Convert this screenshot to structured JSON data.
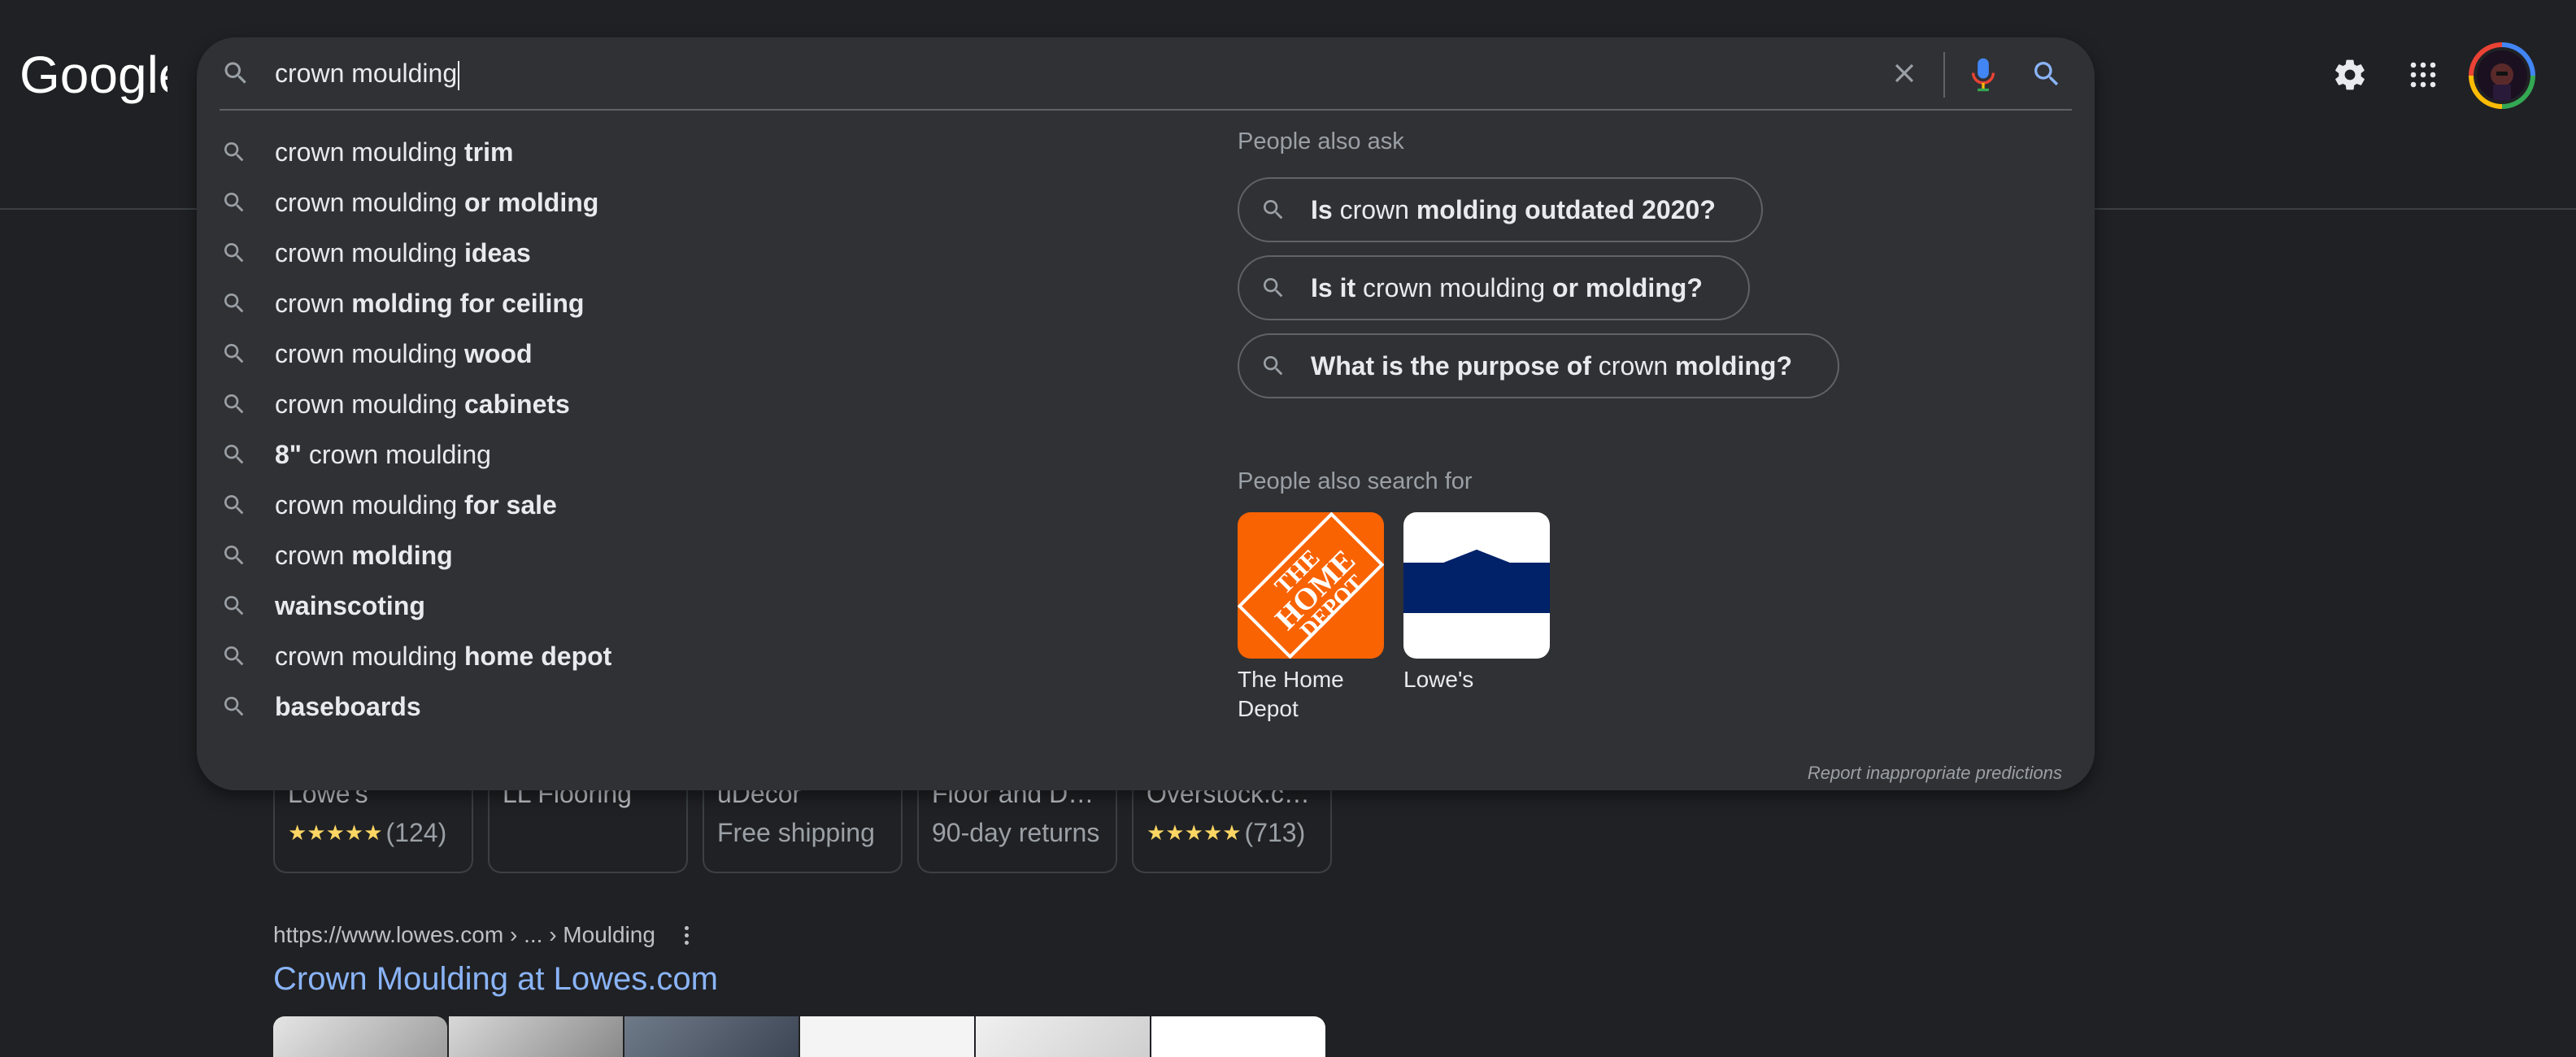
{
  "brand": {
    "logo_text": "Google"
  },
  "search": {
    "query": "crown moulding",
    "clear_icon": "close-icon",
    "voice_icon": "mic-icon",
    "submit_icon": "search-icon"
  },
  "header": {
    "settings_icon": "gear-icon",
    "apps_icon": "apps-grid-icon",
    "avatar_icon": "account-avatar"
  },
  "suggestions": [
    {
      "plain": "crown moulding ",
      "bold": "trim"
    },
    {
      "plain": "crown moulding ",
      "bold": "or molding"
    },
    {
      "plain": "crown moulding ",
      "bold": "ideas"
    },
    {
      "plain": "crown ",
      "bold": "molding for ceiling"
    },
    {
      "plain": "crown moulding ",
      "bold": "wood"
    },
    {
      "plain": "crown moulding ",
      "bold": "cabinets"
    },
    {
      "bold_first": "8\"",
      "plain": " crown moulding"
    },
    {
      "plain": "crown moulding ",
      "bold": "for sale"
    },
    {
      "plain": "crown ",
      "bold": "molding"
    },
    {
      "bold": "wainscoting"
    },
    {
      "plain": "crown moulding ",
      "bold": "home depot"
    },
    {
      "bold": "baseboards"
    }
  ],
  "people_also_ask": {
    "label": "People also ask",
    "questions": [
      {
        "p1_bold": "Is",
        "p2": " crown ",
        "p3_bold": "molding outdated 2020?"
      },
      {
        "p1_bold": "Is it",
        "p2": " crown moulding ",
        "p3_bold": "or molding?"
      },
      {
        "p1_bold": "What is the purpose of",
        "p2": " crown ",
        "p3_bold": "molding?"
      }
    ]
  },
  "people_also_search": {
    "label": "People also search for",
    "items": [
      {
        "name": "The Home Depot",
        "logo_text": "THE HOME DEPOT",
        "color": "#f96302"
      },
      {
        "name": "Lowe's",
        "color": "#012169"
      }
    ]
  },
  "report_link": "Report inappropriate predictions",
  "background": {
    "stores": [
      {
        "name": "Lowe's",
        "rating_stars": "★★★★★",
        "rating_count": "(124)"
      },
      {
        "name": "LL Flooring",
        "sub": ""
      },
      {
        "name": "uDecor",
        "sub": "Free shipping"
      },
      {
        "name": "Floor and De…",
        "sub": "90-day returns"
      },
      {
        "name": "Overstock.co…",
        "rating_stars": "★★★★★",
        "rating_count": "(713)"
      }
    ],
    "result": {
      "url": "https://www.lowes.com › ... › Moulding",
      "title": "Crown Moulding at Lowes.com"
    }
  }
}
